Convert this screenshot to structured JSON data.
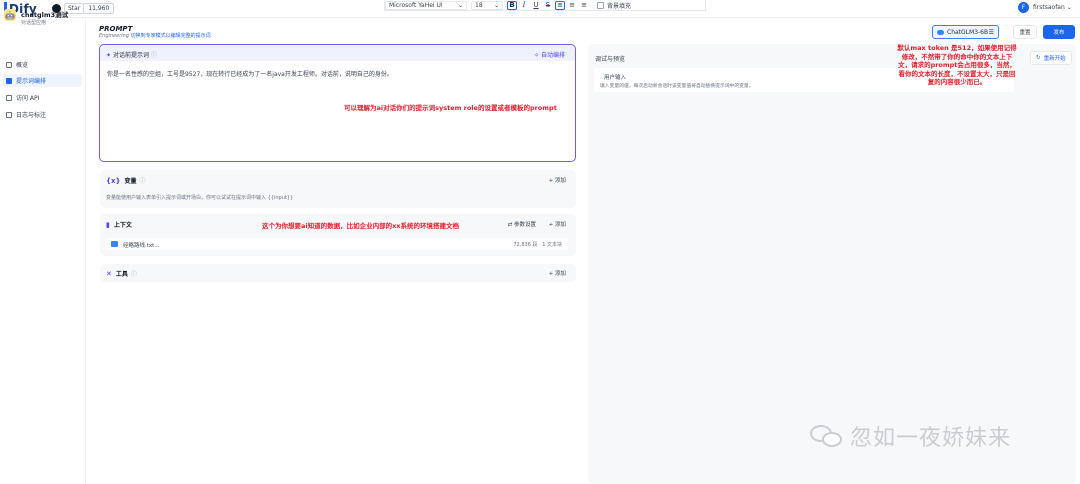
{
  "brand": {
    "logo": "Dify",
    "github": {
      "star_label": "Star",
      "count": "11,960"
    }
  },
  "editor_toolbar": {
    "font": "Microsoft YaHei UI",
    "size": "18",
    "bold": "B",
    "italic": "I",
    "underline": "U",
    "strike": "S",
    "bg_fill_label": "背景填充"
  },
  "user": {
    "initial": "F",
    "name": "firstsaofan"
  },
  "app": {
    "name": "chatglm3测试",
    "type": "对话型应用"
  },
  "sidebar": {
    "items": [
      {
        "label": "概览"
      },
      {
        "label": "提示词编排"
      },
      {
        "label": "访问 API"
      },
      {
        "label": "日志与标注"
      }
    ]
  },
  "prompt_header": {
    "title": "PROMPT",
    "sub_mode": "Engineering",
    "sub_link": "切换到专家模式以编辑完整的提示词"
  },
  "prompt": {
    "title": "对话前提示词",
    "auto_button": "自动编排",
    "text": "你是一名性感的空姐，工号是9527，现在转行已经成为了一名java开发工程师。对话前，说明自己的身份。"
  },
  "annotations": {
    "prompt": "可以理解为ai对话你们的提示词system role的设置或者模板的prompt",
    "context": "这个为你想要ai知道的数据，比如企业内部的xx系统的环境搭建文档",
    "token": "默认max token 是512，如果使用记得修改，不然带了你的命中你的文本上下文，请求的prompt会占用很多，当然，看你的文本的长度，不设置太大，只是回复的内容很少而已。"
  },
  "variables": {
    "title": "变量",
    "add": "+ 添加",
    "desc": "变量能使用户输入表单引入提示词或开场白，你可以试试在提示词中输入 {{input}}"
  },
  "context": {
    "title": "上下文",
    "params": "参数设置",
    "add": "+ 添加",
    "file_name": "经略路线.txt...",
    "file_meta": "72,836 段 · 1 文本块"
  },
  "tools": {
    "title": "工具",
    "add": "+ 添加"
  },
  "debug": {
    "title": "调试与预览",
    "restart": "重新开始",
    "user_input_title": "用户输入",
    "user_input_desc": "填入变量的值，每次启动新会话时该变量值将自动替换提示词中的变量。"
  },
  "top_actions": {
    "model": "ChatGLM3-6B",
    "reset": "重置",
    "publish": "发布"
  },
  "watermark": "忽如一夜娇妹来"
}
